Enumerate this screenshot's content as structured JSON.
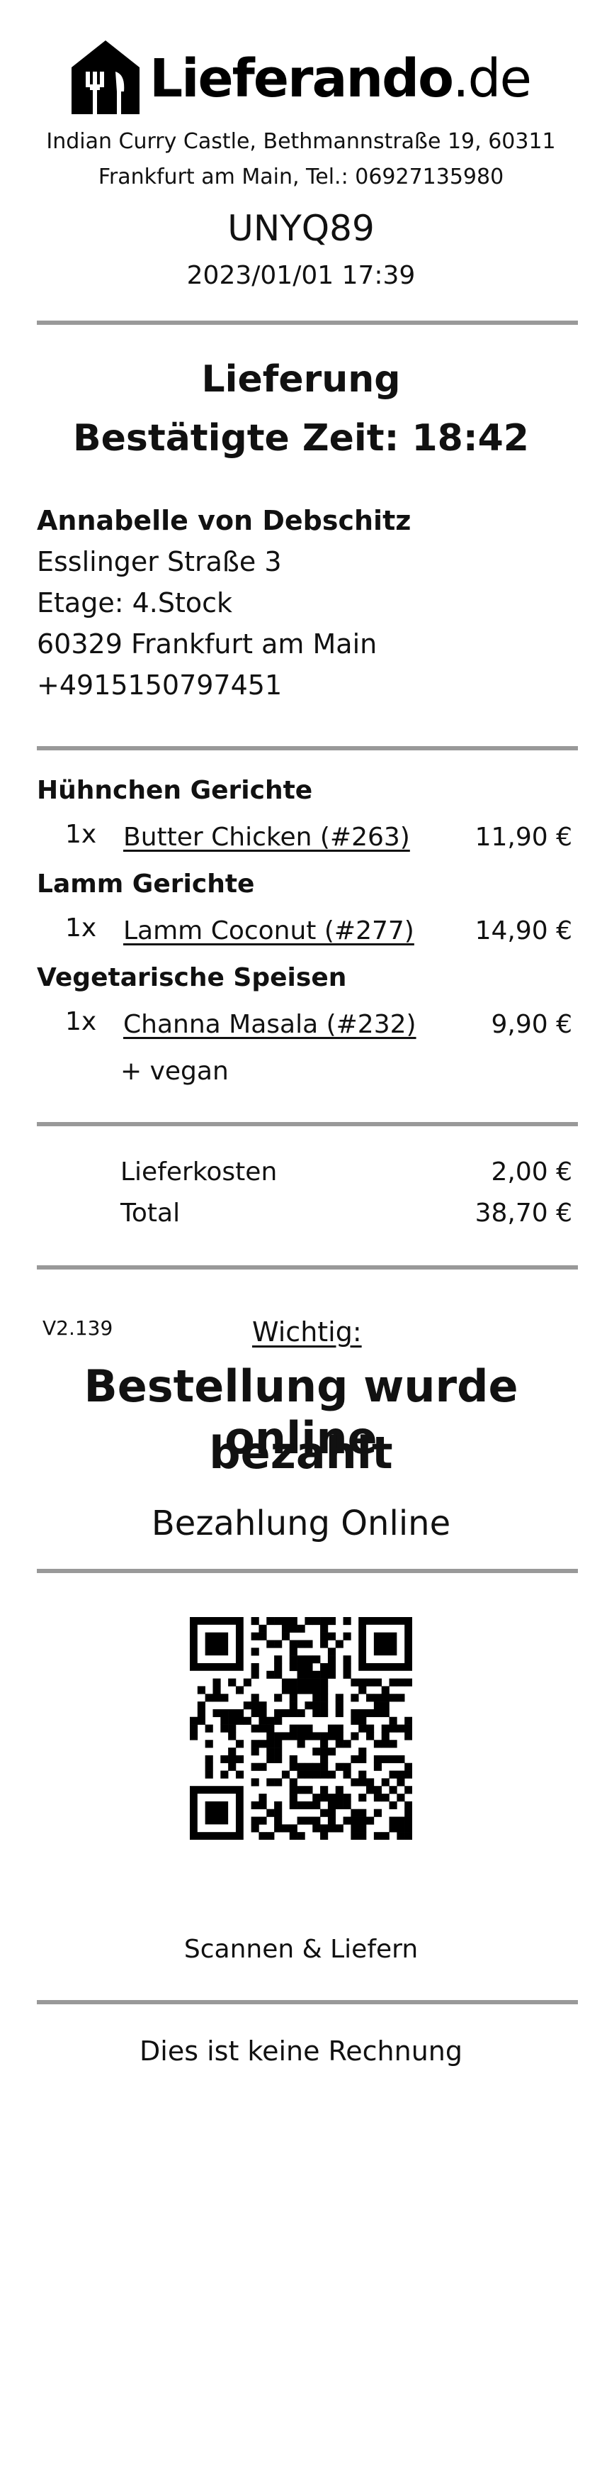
{
  "header": {
    "logo_icon": "house-fork-knife-icon",
    "brand_bold": "Lieferando",
    "brand_domain": ".de",
    "restaurant_line1": "Indian Curry Castle, Bethmannstraße 19, 60311",
    "restaurant_line2": "Frankfurt am Main, Tel.: 06927135980",
    "order_code": "UNYQ89",
    "order_datetime": "2023/01/01 17:39"
  },
  "delivery": {
    "type": "Lieferung",
    "confirmed_time": "Bestätigte Zeit: 18:42"
  },
  "customer": {
    "name": "Annabelle von Debschitz",
    "street": "Esslinger Straße 3",
    "floor": "Etage: 4.Stock",
    "city": "60329 Frankfurt am Main",
    "phone": "+4915150797451"
  },
  "order": {
    "categories": [
      {
        "name": "Hühnchen Gerichte",
        "qty": "1x",
        "item": "Butter Chicken (#263)",
        "price": "11,90 €"
      },
      {
        "name": "Lamm Gerichte",
        "qty": "1x",
        "item": "Lamm Coconut (#277)",
        "price": "14,90 €"
      },
      {
        "name": "Vegetarische Speisen",
        "qty": "1x",
        "item": "Channa Masala (#232)",
        "price": "9,90 €",
        "extra": "+ vegan"
      }
    ]
  },
  "totals": {
    "delivery_label": "Lieferkosten",
    "delivery_value": "2,00 €",
    "total_label": "Total",
    "total_value": "38,70 €"
  },
  "payment": {
    "version": "V2.139",
    "important_label": "Wichtig:",
    "notice_line1": "Bestellung wurde online",
    "notice_line2": "bezahlt",
    "method": "Bezahlung Online"
  },
  "footer": {
    "qr_icon": "qr-code-icon",
    "scan_label": "Scannen & Liefern",
    "disclaimer": "Dies ist keine Rechnung"
  }
}
